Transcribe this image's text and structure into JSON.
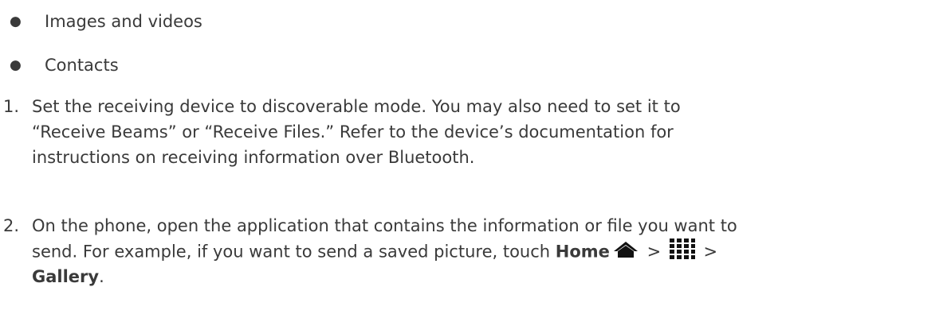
{
  "bullets": [
    {
      "marker": "●",
      "text": "Images and videos"
    },
    {
      "marker": "●",
      "text": "Contacts"
    }
  ],
  "steps": [
    {
      "number": "1.",
      "lines": [
        "Set the receiving device to discoverable mode. You may also need to set it to",
        "“Receive Beams” or “Receive Files.” Refer to the device’s documentation for",
        "instructions on receiving information over Bluetooth."
      ]
    },
    {
      "number": "2.",
      "line1": "On the phone, open the application that contains the information or file you want to",
      "line2_prefix": "send. For example, if you want to send a saved picture, touch ",
      "home_label": "Home",
      "separator1": " > ",
      "separator2": " >",
      "gallery_label": "Gallery",
      "end_punct": ".",
      "icons": [
        "home-icon",
        "all-apps-grid-icon"
      ]
    }
  ],
  "colors": {
    "text": "#3a3a3a",
    "icon": "#111111"
  }
}
